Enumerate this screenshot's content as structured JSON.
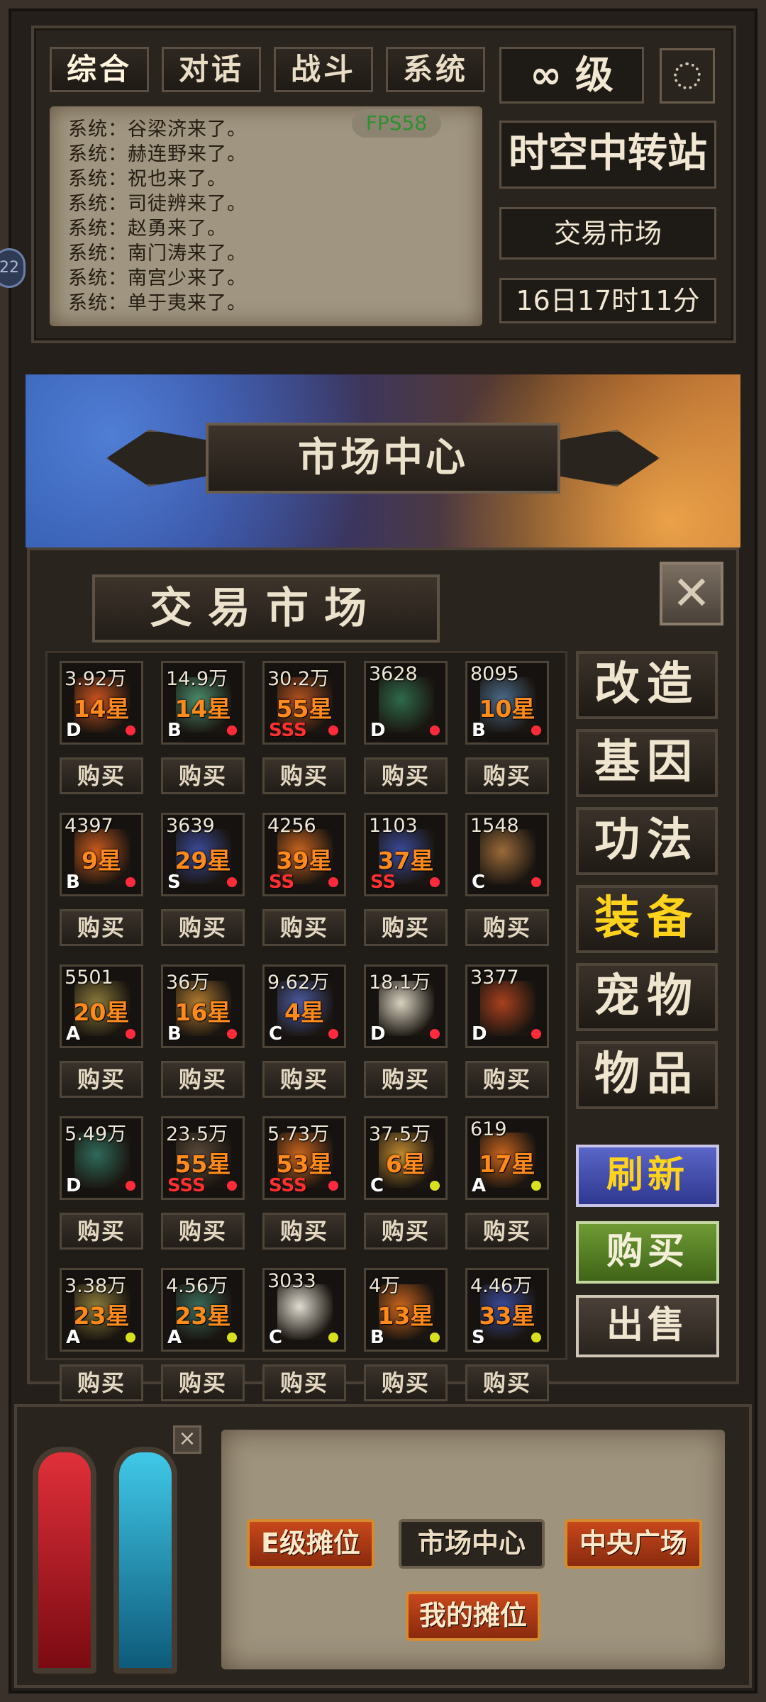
{
  "tabs": [
    {
      "label": "综合",
      "active": true
    },
    {
      "label": "对话",
      "active": false
    },
    {
      "label": "战斗",
      "active": false
    },
    {
      "label": "系统",
      "active": false
    }
  ],
  "level": "∞ 级",
  "fps": "FPS58",
  "chat": [
    "系统：谷梁济来了。",
    "系统：赫连野来了。",
    "系统：祝也来了。",
    "系统：司徒辨来了。",
    "系统：赵勇来了。",
    "系统：南门涛来了。",
    "系统：南宫少来了。",
    "系统：单于夷来了。"
  ],
  "location": {
    "station": "时空中转站",
    "area": "交易市场",
    "time": "16日17时11分"
  },
  "side_bubble": "22",
  "banner_title": "市场中心",
  "market_title": "交易市场",
  "close_icon": "close-icon",
  "buy_label": "购买",
  "items": [
    {
      "price": "3.92万",
      "stars": "14星",
      "grade": "D",
      "grade_red": false,
      "dot": "#ff2a3a",
      "art": "#c7521e"
    },
    {
      "price": "14.9万",
      "stars": "14星",
      "grade": "B",
      "grade_red": false,
      "dot": "#ff2a3a",
      "art": "#4a8a6a"
    },
    {
      "price": "30.2万",
      "stars": "55星",
      "grade": "SSS",
      "grade_red": true,
      "dot": "#ff2a3a",
      "art": "#b05020"
    },
    {
      "price": "3628",
      "stars": "",
      "grade": "D",
      "grade_red": false,
      "dot": "#ff2a3a",
      "art": "#2e6a4a"
    },
    {
      "price": "8095",
      "stars": "10星",
      "grade": "B",
      "grade_red": false,
      "dot": "#ff2a3a",
      "art": "#4a6a8a"
    },
    {
      "price": "4397",
      "stars": "9星",
      "grade": "B",
      "grade_red": false,
      "dot": "#ff2a3a",
      "art": "#c85a1e"
    },
    {
      "price": "3639",
      "stars": "29星",
      "grade": "S",
      "grade_red": false,
      "dot": "#ff2a3a",
      "art": "#3a4a9a"
    },
    {
      "price": "4256",
      "stars": "39星",
      "grade": "SS",
      "grade_red": true,
      "dot": "#ff2a3a",
      "art": "#c8641e"
    },
    {
      "price": "1103",
      "stars": "37星",
      "grade": "SS",
      "grade_red": true,
      "dot": "#ff2a3a",
      "art": "#3a4a9a"
    },
    {
      "price": "1548",
      "stars": "",
      "grade": "C",
      "grade_red": false,
      "dot": "#ff2a3a",
      "art": "#9a6a3a"
    },
    {
      "price": "5501",
      "stars": "20星",
      "grade": "A",
      "grade_red": false,
      "dot": "#ff2a3a",
      "art": "#8a7a3a"
    },
    {
      "price": "36万",
      "stars": "16星",
      "grade": "B",
      "grade_red": false,
      "dot": "#ff2a3a",
      "art": "#b07a30"
    },
    {
      "price": "9.62万",
      "stars": "4星",
      "grade": "C",
      "grade_red": false,
      "dot": "#ff2a3a",
      "art": "#4a5aa0"
    },
    {
      "price": "18.1万",
      "stars": "",
      "grade": "D",
      "grade_red": false,
      "dot": "#ff2a3a",
      "art": "#d8d2c0"
    },
    {
      "price": "3377",
      "stars": "",
      "grade": "D",
      "grade_red": false,
      "dot": "#ff2a3a",
      "art": "#a8401e"
    },
    {
      "price": "5.49万",
      "stars": "",
      "grade": "D",
      "grade_red": false,
      "dot": "#ff2a3a",
      "art": "#2e6a5a"
    },
    {
      "price": "23.5万",
      "stars": "55星",
      "grade": "SSS",
      "grade_red": true,
      "dot": "#ff2a3a",
      "art": "#5a4a3a"
    },
    {
      "price": "5.73万",
      "stars": "53星",
      "grade": "SSS",
      "grade_red": true,
      "dot": "#ff2a3a",
      "art": "#c8641e"
    },
    {
      "price": "37.5万",
      "stars": "6星",
      "grade": "C",
      "grade_red": false,
      "dot": "#d8e020",
      "art": "#c08a30"
    },
    {
      "price": "619",
      "stars": "17星",
      "grade": "A",
      "grade_red": false,
      "dot": "#d8e020",
      "art": "#c8641e"
    },
    {
      "price": "3.38万",
      "stars": "23星",
      "grade": "A",
      "grade_red": false,
      "dot": "#d8e020",
      "art": "#8a7a3a"
    },
    {
      "price": "4.56万",
      "stars": "23星",
      "grade": "A",
      "grade_red": false,
      "dot": "#d8e020",
      "art": "#3a6a5a"
    },
    {
      "price": "3033",
      "stars": "",
      "grade": "C",
      "grade_red": false,
      "dot": "#d8e020",
      "art": "#e0dcd0"
    },
    {
      "price": "4万",
      "stars": "13星",
      "grade": "B",
      "grade_red": false,
      "dot": "#d8e020",
      "art": "#c8641e"
    },
    {
      "price": "4.46万",
      "stars": "33星",
      "grade": "S",
      "grade_red": false,
      "dot": "#d8e020",
      "art": "#3a4a9a"
    }
  ],
  "categories": [
    {
      "label": "改造",
      "active": false
    },
    {
      "label": "基因",
      "active": false
    },
    {
      "label": "功法",
      "active": false
    },
    {
      "label": "装备",
      "active": true
    },
    {
      "label": "宠物",
      "active": false
    },
    {
      "label": "物品",
      "active": false
    }
  ],
  "actions": {
    "refresh": "刷新",
    "buy": "购买",
    "sell": "出售"
  },
  "nav": {
    "e_stall": "E级摊位",
    "market_center": "市场中心",
    "central_square": "中央广场",
    "my_stall": "我的摊位"
  },
  "mini_close": "×",
  "colors": {
    "accent_yellow": "#ffd21c",
    "star_orange": "#ff8a1c",
    "fps_green": "#2f8f31",
    "refresh_bg": "#3f4aa8",
    "buy_bg": "#4f7a24",
    "sell_bg": "#3a322a"
  }
}
